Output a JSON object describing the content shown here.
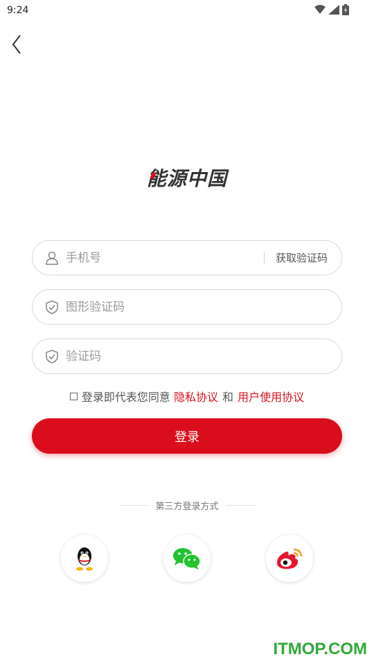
{
  "status_bar": {
    "time": "9:24"
  },
  "header": {
    "back_icon": "chevron-left-icon"
  },
  "logo": {
    "text": "能源中国"
  },
  "form": {
    "phone": {
      "placeholder": "手机号",
      "icon": "user-icon"
    },
    "get_code_label": "获取验证码",
    "captcha": {
      "placeholder": "图形验证码",
      "icon": "shield-check-icon"
    },
    "sms_code": {
      "placeholder": "验证码",
      "icon": "shield-check-icon"
    }
  },
  "agreement": {
    "prefix": "登录即代表您同意",
    "privacy_link": "隐私协议",
    "and": "和",
    "terms_link": "用户使用协议"
  },
  "login_button": "登录",
  "third_party": {
    "title": "第三方登录方式",
    "providers": [
      {
        "name": "QQ",
        "icon": "qq-icon"
      },
      {
        "name": "WeChat",
        "icon": "wechat-icon"
      },
      {
        "name": "Weibo",
        "icon": "weibo-icon"
      }
    ]
  },
  "watermark": "ITMOP.COM",
  "colors": {
    "accent": "#d90d1b",
    "watermark": "#2faa38"
  }
}
